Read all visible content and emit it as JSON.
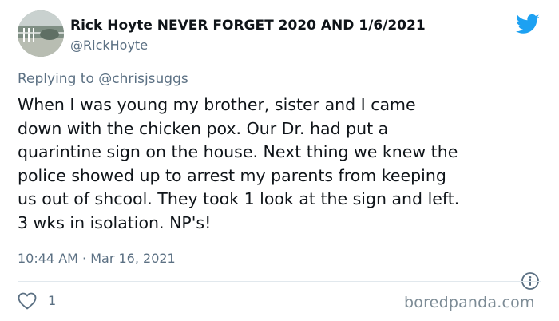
{
  "user": {
    "display_name": "Rick Hoyte NEVER FORGET 2020 AND 1/6/2021",
    "handle": "@RickHoyte",
    "avatar_icon": "profile-photo"
  },
  "brand": {
    "icon": "twitter-bird-icon",
    "color": "#1da1f2"
  },
  "reply": {
    "prefix": "Replying to",
    "mention": "@chrisjsuggs"
  },
  "tweet": {
    "lines": [
      "When I was young my brother, sister and I came",
      "down with the chicken pox. Our Dr. had put a",
      "quarintine sign on the house. Next thing we knew the",
      "police showed up to arrest my parents from keeping",
      "us out of shcool. They took 1 look at the sign and left.",
      "3 wks in isolation. NP's!"
    ],
    "timestamp": "10:44 AM · Mar 16, 2021"
  },
  "actions": {
    "like_icon": "heart-icon",
    "like_count": "1",
    "info_icon": "info-icon"
  },
  "watermark": "boredpanda.com"
}
